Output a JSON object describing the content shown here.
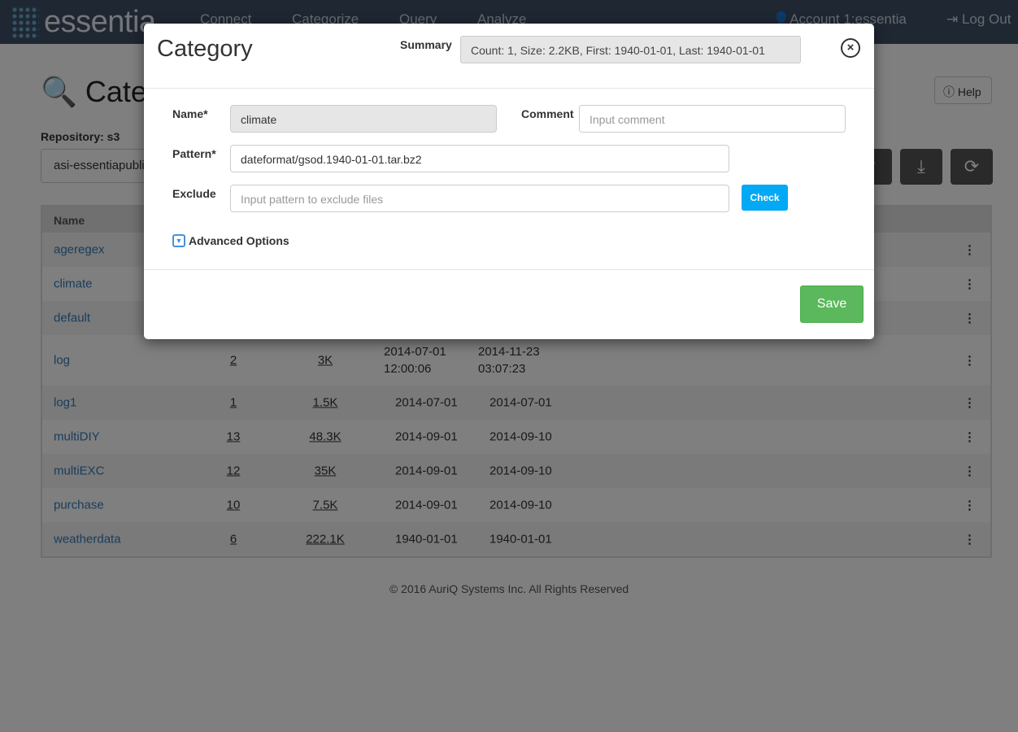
{
  "nav": {
    "brand": "essentia",
    "items": [
      "Connect",
      "Categorize",
      "Query",
      "Analyze"
    ],
    "account": "Account 1:essentia",
    "logout": "Log Out"
  },
  "page": {
    "title": "Categories",
    "repository_label": "Repository: s3",
    "repository_value": "asi-essentiapublic",
    "help": "Help"
  },
  "table": {
    "headers": [
      "Name"
    ],
    "rows": [
      {
        "name": "ageregex",
        "count": "",
        "size": "",
        "first": "",
        "last": ""
      },
      {
        "name": "climate",
        "count": "",
        "size": "",
        "first": "",
        "last": ""
      },
      {
        "name": "default",
        "count": "",
        "size": "",
        "first": "",
        "last": ""
      },
      {
        "name": "log",
        "count": "2",
        "size": "3K",
        "first": "2014-07-01 12:00:06",
        "last": "2014-11-23 03:07:23"
      },
      {
        "name": "log1",
        "count": "1",
        "size": "1.5K",
        "first": "2014-07-01",
        "last": "2014-07-01"
      },
      {
        "name": "multiDIY",
        "count": "13",
        "size": "48.3K",
        "first": "2014-09-01",
        "last": "2014-09-10"
      },
      {
        "name": "multiEXC",
        "count": "12",
        "size": "35K",
        "first": "2014-09-01",
        "last": "2014-09-10"
      },
      {
        "name": "purchase",
        "count": "10",
        "size": "7.5K",
        "first": "2014-09-01",
        "last": "2014-09-10"
      },
      {
        "name": "weatherdata",
        "count": "6",
        "size": "222.1K",
        "first": "1940-01-01",
        "last": "1940-01-01"
      }
    ]
  },
  "footer": "© 2016 AuriQ Systems Inc. All Rights Reserved",
  "modal": {
    "title": "Category",
    "summary_label": "Summary",
    "summary": "Count: 1, Size: 2.2KB, First: 1940-01-01, Last: 1940-01-01",
    "name_label": "Name*",
    "name_value": "climate",
    "comment_label": "Comment",
    "comment_placeholder": "Input comment",
    "pattern_label": "Pattern*",
    "pattern_value": "dateformat/gsod.1940-01-01.tar.bz2",
    "exclude_label": "Exclude",
    "exclude_placeholder": "Input pattern to exclude files",
    "check": "Check",
    "advanced": "Advanced Options",
    "save": "Save"
  },
  "colors": {
    "save": "#5cb85c",
    "check": "#03a9f4",
    "link": "#337ab7"
  }
}
